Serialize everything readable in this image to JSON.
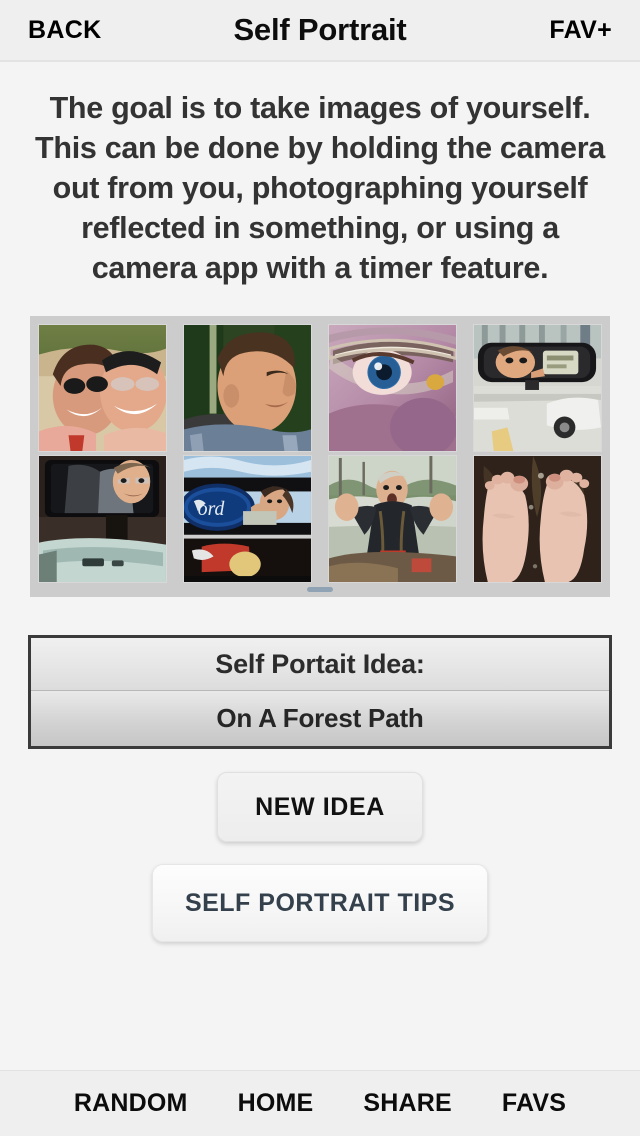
{
  "header": {
    "back_label": "BACK",
    "title": "Self Portrait",
    "fav_label": "FAV+"
  },
  "description": {
    "text": "The goal is to take images of yourself. This can be done by holding the camera out from you, photographing yourself reflected in something, or using a camera app with a timer feature."
  },
  "gallery": {
    "rows": [
      [
        {
          "alt": "two-people-selfie-on-beach"
        },
        {
          "alt": "man-profile-eyes-closed-outdoors"
        },
        {
          "alt": "close-up-eye-behind-eyeglasses"
        },
        {
          "alt": "face-reflected-in-car-rearview-mirror"
        }
      ],
      [
        {
          "alt": "man-reflected-in-car-side-window"
        },
        {
          "alt": "reflection-in-ford-car-grille-chrome"
        },
        {
          "alt": "man-with-raised-hands-on-boat"
        },
        {
          "alt": "bare-feet-on-dark-ground"
        }
      ]
    ]
  },
  "idea": {
    "label": "Self Portait Idea:",
    "value": "On A Forest Path"
  },
  "actions": {
    "new_idea_label": "NEW IDEA",
    "tips_label": "SELF PORTRAIT TIPS"
  },
  "tabbar": {
    "items": [
      {
        "label": "RANDOM"
      },
      {
        "label": "HOME"
      },
      {
        "label": "SHARE"
      },
      {
        "label": "FAVS"
      }
    ]
  },
  "colors": {
    "screen_background": "#f4f4f4",
    "bar_background": "#efefef",
    "gallery_background": "#cccccc",
    "idea_border": "#3a3a3a",
    "tips_text": "#34414d",
    "description_text": "#333333"
  }
}
